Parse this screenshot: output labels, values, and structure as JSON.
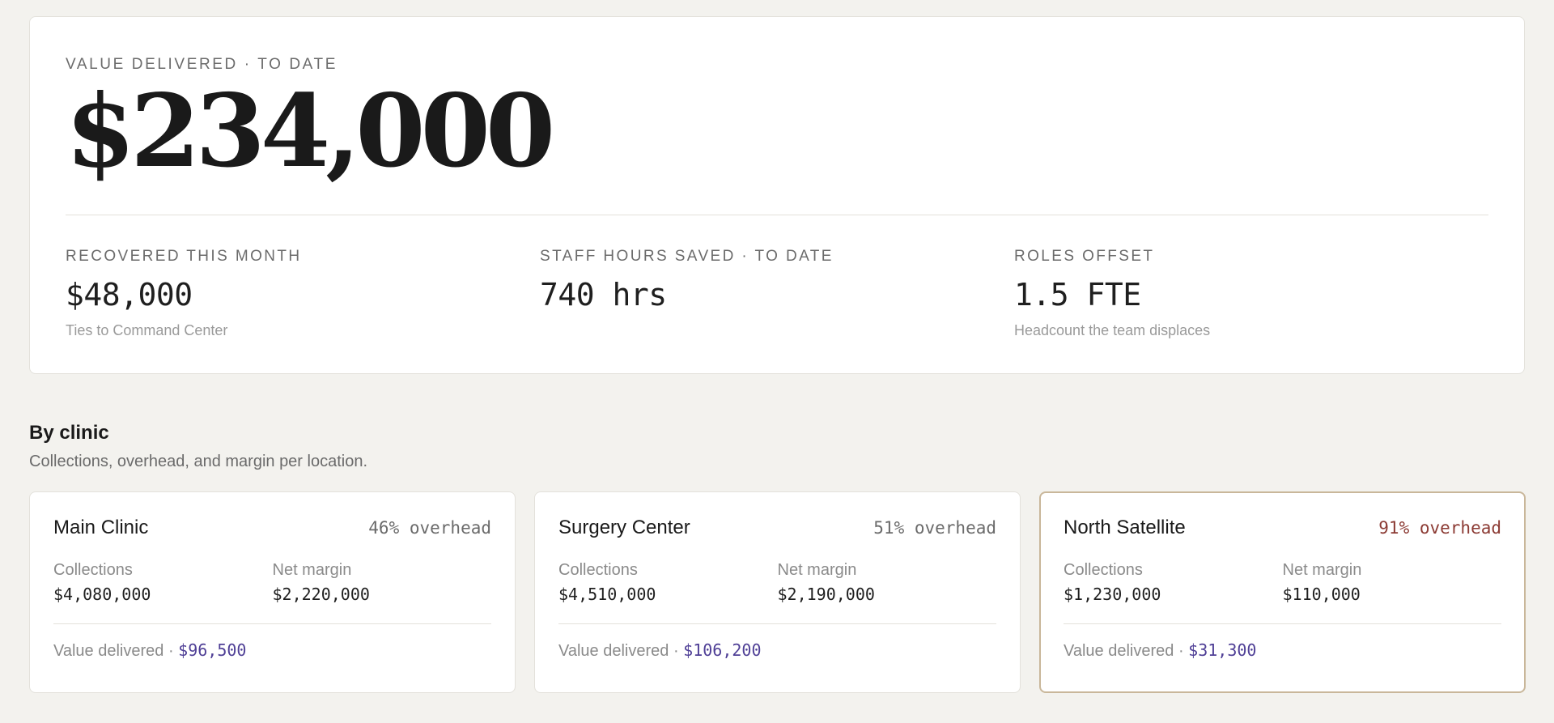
{
  "hero": {
    "eyebrow": "VALUE DELIVERED · TO DATE",
    "amount": "$234,000"
  },
  "stats": [
    {
      "label": "RECOVERED THIS MONTH",
      "value": "$48,000",
      "sub": "Ties to Command Center"
    },
    {
      "label": "STAFF HOURS SAVED · TO DATE",
      "value": "740 hrs",
      "sub": ""
    },
    {
      "label": "ROLES OFFSET",
      "value": "1.5 FTE",
      "sub": "Headcount the team displaces"
    }
  ],
  "section": {
    "title": "By clinic",
    "subtitle": "Collections, overhead, and margin per location."
  },
  "clinics": [
    {
      "name": "Main Clinic",
      "overhead": "46% overhead",
      "collections_label": "Collections",
      "collections": "$4,080,000",
      "margin_label": "Net margin",
      "margin": "$2,220,000",
      "value_label": "Value delivered · ",
      "value": "$96,500"
    },
    {
      "name": "Surgery Center",
      "overhead": "51% overhead",
      "collections_label": "Collections",
      "collections": "$4,510,000",
      "margin_label": "Net margin",
      "margin": "$2,190,000",
      "value_label": "Value delivered · ",
      "value": "$106,200"
    },
    {
      "name": "North Satellite",
      "overhead": "91% overhead",
      "collections_label": "Collections",
      "collections": "$1,230,000",
      "margin_label": "Net margin",
      "margin": "$110,000",
      "value_label": "Value delivered · ",
      "value": "$31,300"
    }
  ],
  "colors": {
    "background": "#f3f2ee",
    "card": "#ffffff",
    "accent_value": "#4f3f96",
    "alert_overhead": "#8c3b34",
    "flagged_border": "#c9b79a"
  }
}
